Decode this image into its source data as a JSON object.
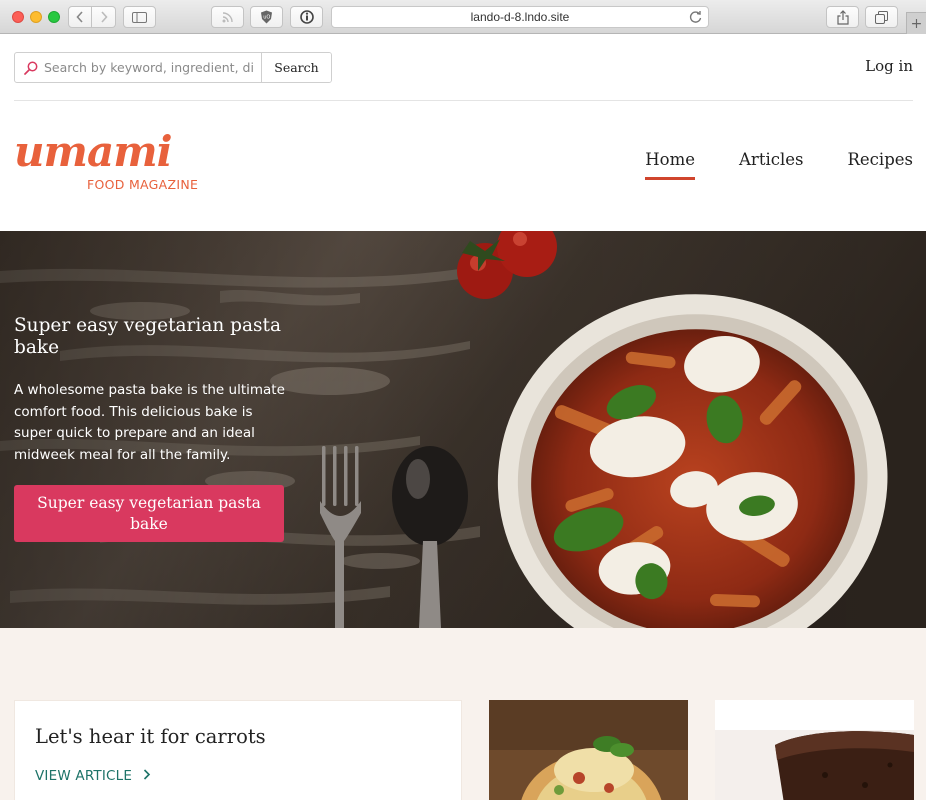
{
  "browser": {
    "url": "lando-d-8.lndo.site"
  },
  "topbar": {
    "search_placeholder": "Search by keyword, ingredient, dish",
    "search_button": "Search",
    "login": "Log in"
  },
  "brand": {
    "logo_word": "umami",
    "logo_sub": "FOOD MAGAZINE",
    "color": "#e8613c"
  },
  "nav": {
    "items": [
      {
        "label": "Home",
        "active": true
      },
      {
        "label": "Articles",
        "active": false
      },
      {
        "label": "Recipes",
        "active": false
      }
    ],
    "active_underline_color": "#d0452d"
  },
  "hero": {
    "title": "Super easy vegetarian pasta bake",
    "description": "A wholesome pasta bake is the ultimate comfort food. This delicious bake is super quick to prepare and an ideal midweek meal for all the family.",
    "button": "Super easy vegetarian pasta bake",
    "button_color": "#d9395f"
  },
  "featured": {
    "card_title": "Let's hear it for carrots",
    "card_link": "VIEW ARTICLE",
    "link_color": "#1d7368"
  }
}
